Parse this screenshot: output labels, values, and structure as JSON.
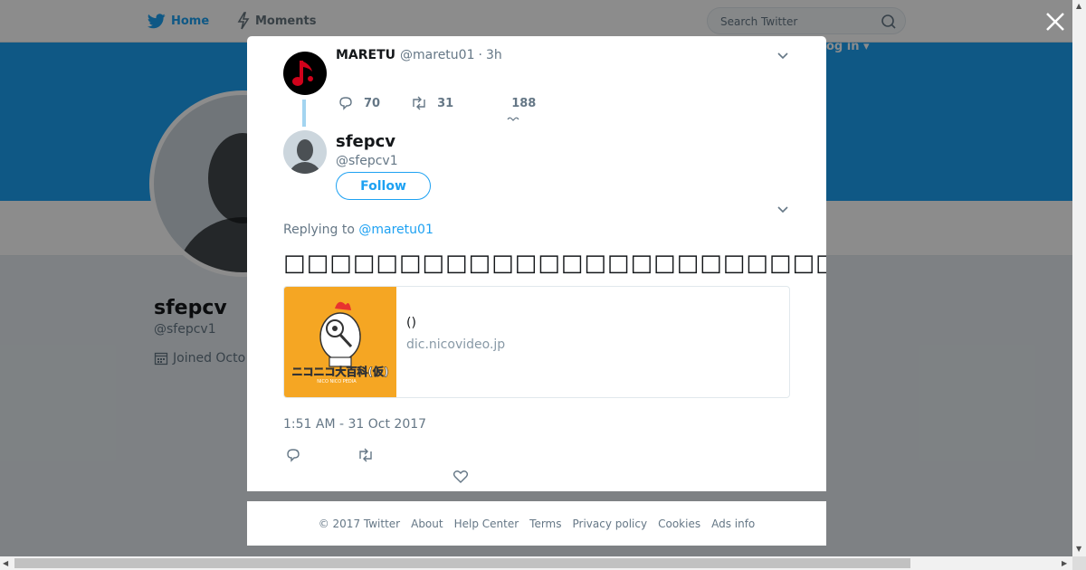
{
  "topbar": {
    "home_label": "Home",
    "moments_label": "Moments",
    "search_placeholder": "Search Twitter",
    "login_label": "og in ▾"
  },
  "profile": {
    "name": "sfepcv",
    "handle": "@sfepcv1",
    "joined": "Joined Octo"
  },
  "parent_tweet": {
    "name": "MARETU",
    "handle": "@maretu01",
    "separator": "·",
    "time_ago": "3h",
    "replies": "70",
    "retweets": "31",
    "likes": "188"
  },
  "tweet": {
    "author_name": "sfepcv",
    "author_handle": "@sfepcv1",
    "follow_label": "Follow",
    "replying_prefix": "Replying to",
    "replying_handle": "@maretu01",
    "text": "□□□□□□□□□□□□□□□□□□□□□□□□□□□□□□□□□□□□□□□□□□□□□",
    "card": {
      "title": "()",
      "domain": "dic.nicovideo.jp",
      "thumb_text": "ニコニコ大百科(仮)",
      "thumb_subtext": "NICO NICO PEDIA"
    },
    "timestamp": "1:51 AM - 31 Oct 2017"
  },
  "footer": {
    "copyright": "© 2017 Twitter",
    "links": [
      "About",
      "Help Center",
      "Terms",
      "Privacy policy",
      "Cookies",
      "Ads info"
    ]
  },
  "colors": {
    "accent": "#1da1f2",
    "banner": "#1da1f2",
    "card_thumb": "#f5a623",
    "overlay": "rgba(0,0,0,0.45)"
  }
}
